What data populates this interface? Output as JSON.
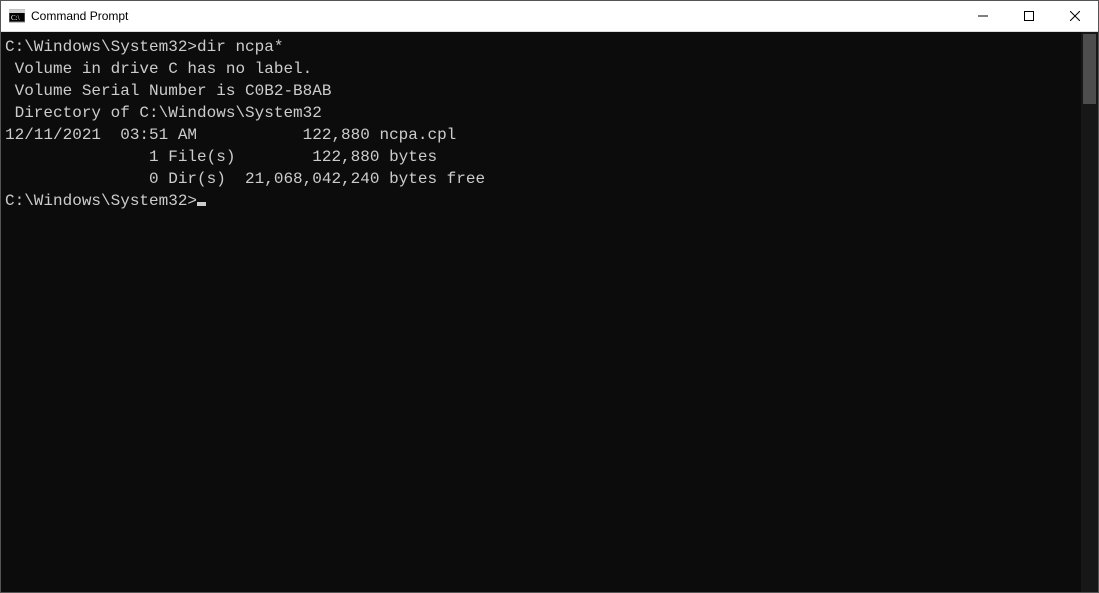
{
  "window": {
    "title": "Command Prompt"
  },
  "terminal": {
    "blank_top": "",
    "prompt1_path": "C:\\Windows\\System32>",
    "prompt1_cmd": "dir ncpa*",
    "line_volume": " Volume in drive C has no label.",
    "line_serial": " Volume Serial Number is C0B2-B8AB",
    "blank1": "",
    "line_dirof": " Directory of C:\\Windows\\System32",
    "blank2": "",
    "line_entry": "12/11/2021  03:51 AM           122,880 ncpa.cpl",
    "line_files": "               1 File(s)        122,880 bytes",
    "line_dirs": "               0 Dir(s)  21,068,042,240 bytes free",
    "blank3": "",
    "prompt2_path": "C:\\Windows\\System32>"
  }
}
